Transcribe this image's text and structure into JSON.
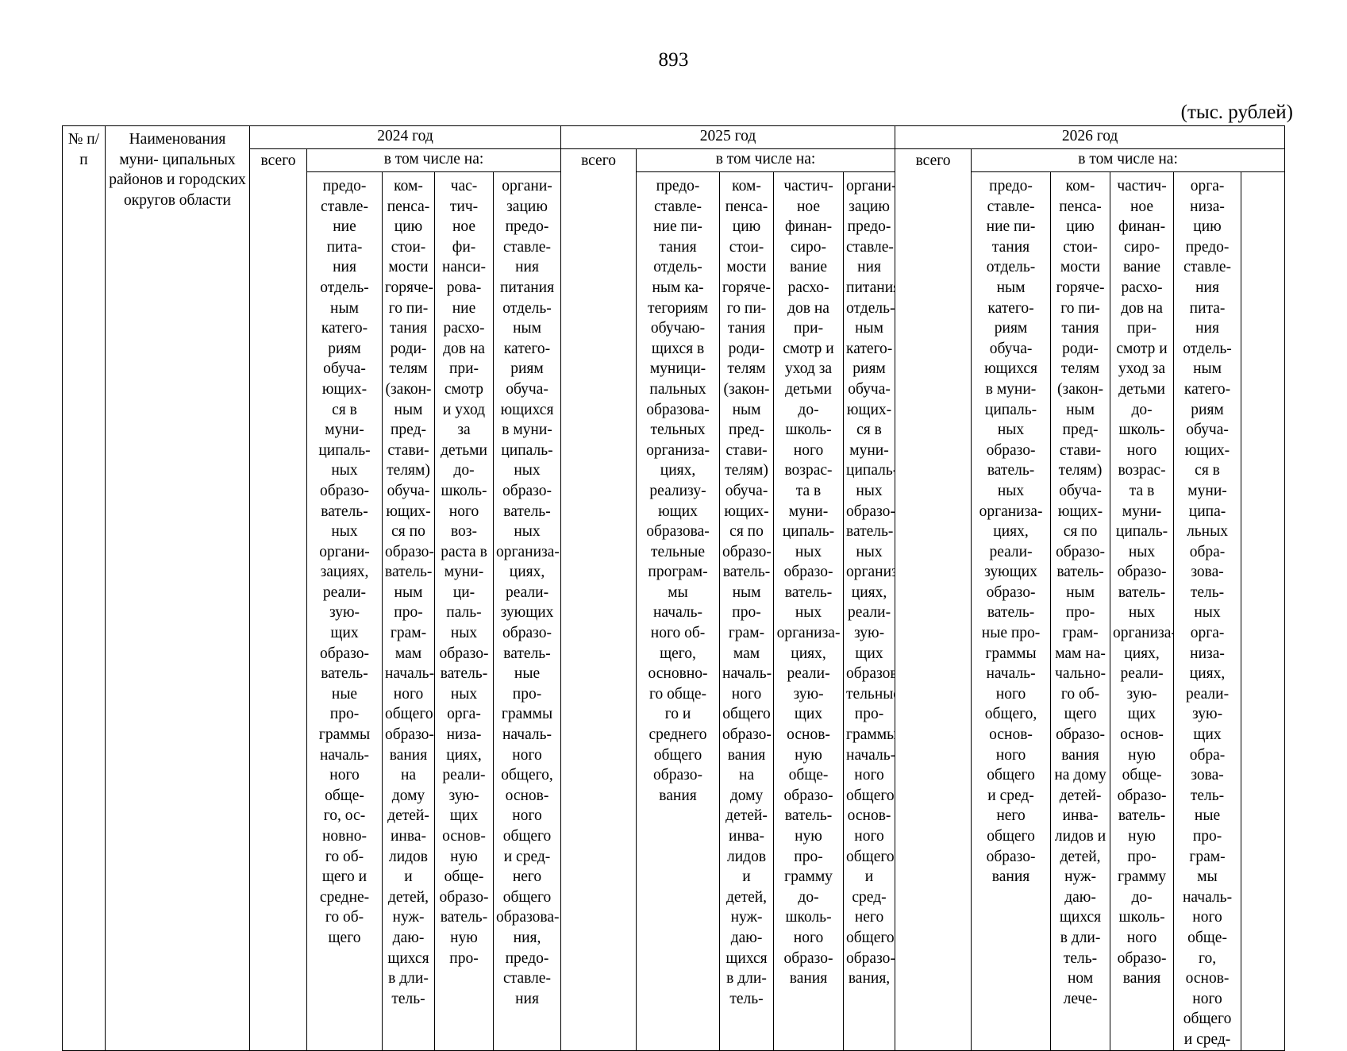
{
  "page": {
    "number": "893",
    "units_note": "(тыс. рублей)"
  },
  "table": {
    "col_index_header": "№\nп/п",
    "col_name_header": "Наименования муни-\nципальных районов и\nгородских округов\nобласти",
    "total_label": "всего",
    "including_label": "в том числе на:",
    "years": [
      {
        "label": "2024 год"
      },
      {
        "label": "2025 год"
      },
      {
        "label": "2026 год"
      }
    ],
    "subheaders_2024": [
      "предо-\nставле-\nние\nпита-\nния\nотдель-\nным\nкатего-\nриям\nобуча-\nющих-\nся в\nмуни-\nципаль-\nных\nобразо-\nватель-\nных\nоргани-\nзациях,\nреали-\nзую-\nщих\nобразо-\nватель-\nные\nпро-\nграммы\nначаль-\nного\nобще-\nго, ос-\nновно-\nго об-\nщего и\nсредне-\nго об-\nщего",
      "ком-\nпенса-\nцию\nстои-\nмости\nгоряче-\nго пи-\nтания\nроди-\nтелям\n(закон-\nным\nпред-\nстави-\nтелям)\nобуча-\nющих-\nся по\nобразо-\nватель-\nным\nпро-\nграм-\nмам\nначаль-\nного\nобщего\nобразо-\nвания на\nдому\nдетей-\nинва-\nлидов и\nдетей,\nнуж-\nдаю-\nщихся\nв дли-\nтель-",
      "час-\nтич-\nное\nфи-\nнанси-\nрова-\nние\nрасхо-\nдов на\nпри-\nсмотр\nи уход\nза\nдетьми\nдо-\nшколь-\nного\nвоз-\nраста в\nмуни-\nци-\nпаль-\nных\nобразо-\nватель-\nных\nорга-\nниза-\nциях,\nреали-\nзую-\nщих\nоснов-\nную\nобще-\nобразо-\nватель-\nную\nпро-",
      "органи-\nзацию\nпредо-\nставле-\nния\nпитания\nотдель-\nным\nкатего-\nриям\nобуча-\nющихся\nв муни-\nципаль-\nных\nобразо-\nватель-\nных\nорганиза-\nциях,\nреали-\nзующих\nобразо-\nватель-\nные\nпро-\nграммы\nначаль-\nного\nобщего,\nоснов-\nного\nобщего\nи сред-\nнего\nобщего\nобразова-\nния,\nпредо-\nставле-\nния"
    ],
    "subheaders_2025": [
      "предо-\nставле-\nние пи-\nтания\nотдель-\nным ка-\nтегориям\nобучаю-\nщихся в\nмуници-\nпальных\nобразова-\nтельных\nорганиза-\nциях,\nреализу-\nющих\nобразова-\nтельные\nпрограм-\nмы\nначаль-\nного об-\nщего,\nосновно-\nго обще-\nго и\nсреднего\nобщего\nобразо-\nвания",
      "ком-\nпенса-\nцию\nстои-\nмости\nгоряче-\nго пи-\nтания\nроди-\nтелям\n(закон-\nным\nпред-\nстави-\nтелям)\nобуча-\nющих-\nся по\nобразо-\nватель-\nным\nпро-\nграм-\nмам\nначаль-\nного\nобщего\nобразо-\nвания на\nдому\nдетей-\nинва-\nлидов и\nдетей,\nнуж-\nдаю-\nщихся\nв дли-\nтель-",
      "частич-\nное\nфинан-\nсиро-\nвание\nрасхо-\nдов на\nпри-\nсмотр и\nуход за\nдетьми\nдо-\nшколь-\nного\nвозрас-\nта в\nмуни-\nципаль-\nных\nобразо-\nватель-\nных\nорганиза-\nциях,\nреали-\nзую-\nщих\nоснов-\nную\nобще-\nобразо-\nватель-\nную\nпро-\nграмму\nдо-\nшколь-\nного\nобразо-\nвания",
      "органи-\nзацию\nпредо-\nставле-\nния\nпитания\nотдель-\nным\nкатего-\nриям\nобуча-\nющих-\nся в\nмуни-\nципаль-\nных\nобразо-\nватель-\nных\nорганиза-\nциях,\nреали-\nзую-\nщих\nобразова-\nтельные\nпро-\nграммы\nначаль-\nного\nобщего,\nоснов-\nного\nобщего\nи сред-\nнего\nобщего\nобразо-\nвания,",
      "всего"
    ],
    "subheaders_2026": [
      "предо-\nставле-\nние пи-\nтания\nотдель-\nным\nкатего-\nриям\nобуча-\nющихся\nв муни-\nципаль-\nных\nобразо-\nватель-\nных\nорганиза-\nциях,\nреали-\nзующих\nобразо-\nватель-\nные про-\nграммы\nначаль-\nного\nобщего,\nоснов-\nного\nобщего\nи сред-\nнего\nобщего\nобразо-\nвания",
      "ком-\nпенса-\nцию\nстои-\nмости\nгоряче-\nго пи-\nтания\nроди-\nтелям\n(закон-\nным\nпред-\nстави-\nтелям)\nобуча-\nющих-\nся по\nобразо-\nватель-\nным\nпро-\nграм-\nмам на-\nчально-\nго об-\nщего\nобразо-\nвания\nна дому\nдетей-\nинва-\nлидов и\nдетей,\nнуж-\nдаю-\nщихся\nв дли-\nтель-\nном\nлече-",
      "частич-\nное\nфинан-\nсиро-\nвание\nрасхо-\nдов на\nпри-\nсмотр и\nуход за\nдетьми\nдо-\nшколь-\nного\nвозрас-\nта в\nмуни-\nципаль-\nных\nобразо-\nватель-\nных\nорганиза-\nциях,\nреали-\nзую-\nщих\nоснов-\nную\nобще-\nобразо-\nватель-\nную\nпро-\nграмму\nдо-\nшколь-\nного\nобразо-\nвания",
      "орга-\nниза-\nцию\nпредо-\nставле-\nния\nпита-\nния\nотдель-\nным\nкатего-\nриям\nобуча-\nющих-\nся в\nмуни-\nципа-\nльных\nобра-\nзова-\nтель-\nных\nорга-\nниза-\nциях,\nреали-\nзую-\nщих\nобра-\nзова-\nтель-\nные\nпро-\nграм-\nмы\nначаль-\nного\nобще-\nго,\nоснов-\nного\nобщего\nи сред-"
    ]
  }
}
